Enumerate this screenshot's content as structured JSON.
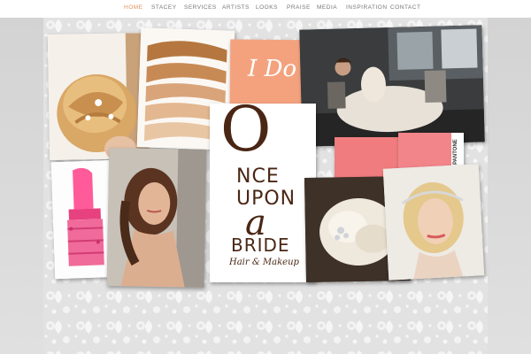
{
  "nav": {
    "items": [
      {
        "label": "HOME",
        "active": true
      },
      {
        "label": "STACEY",
        "active": false
      },
      {
        "label": "SERVICES",
        "active": false
      },
      {
        "label": "ARTISTS",
        "active": false
      },
      {
        "label": "LOOKS",
        "active": false
      },
      {
        "label": "PRAISE",
        "active": false
      },
      {
        "label": "MEDIA",
        "active": false
      },
      {
        "label": "INSPIRATION",
        "active": false
      },
      {
        "label": "CONTACT",
        "active": false
      }
    ],
    "active_color": "#e0935f",
    "text_color": "#777777"
  },
  "collage": {
    "i_do_card": {
      "text": "I Do",
      "color": "#f4a27e"
    },
    "logo": {
      "big_o": "O",
      "line1": "NCE",
      "line2": "UPON",
      "line3": "a",
      "line4": "BRIDE",
      "tagline": "Hair & Makeup",
      "color": "#4a2614"
    },
    "pantone_label": "PANTONE",
    "swatch_color": "#f07c7f"
  }
}
